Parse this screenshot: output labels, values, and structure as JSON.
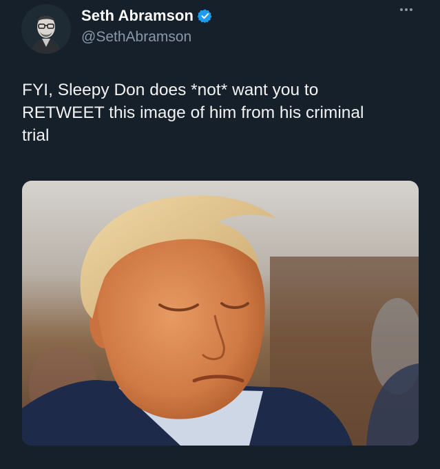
{
  "author": {
    "display_name": "Seth Abramson",
    "handle": "@SethAbramson",
    "verified_icon": "verified-badge-icon",
    "avatar": "avatar"
  },
  "tweet": {
    "text_line1": "FYI, Sleepy Don does *not* want you to",
    "text_line2": "RETWEET this image of him from his criminal",
    "text_line3": "trial"
  },
  "menu": {
    "icon": "more-options-icon"
  },
  "media": {
    "type": "photo"
  },
  "colors": {
    "background": "#15202b",
    "text": "#ffffff",
    "secondary_text": "#8b98a5",
    "verified": "#1d9bf0"
  }
}
